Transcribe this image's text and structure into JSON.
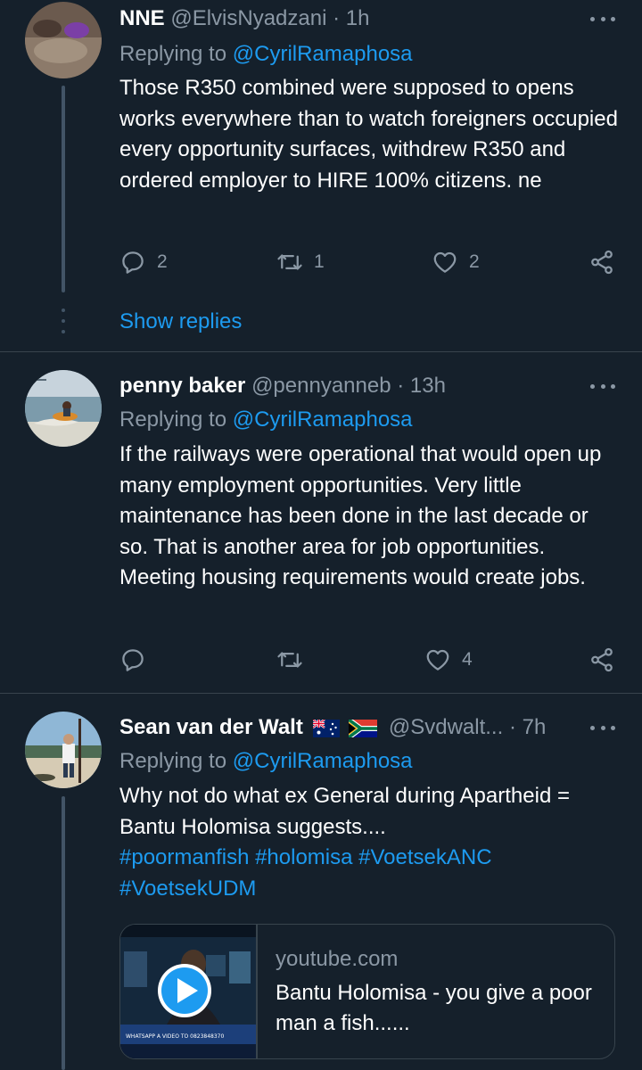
{
  "tweets": [
    {
      "name": "NNE",
      "handle": "@ElvisNyadzani",
      "separator": "·",
      "time": "1h",
      "replying_prefix": "Replying to",
      "replying_to": "@CyrilRamaphosa",
      "text": "Those R350 combined were supposed to opens works everywhere than to watch foreigners occupied every opportunity surfaces, withdrew R350 and ordered employer to HIRE 100% citizens. ne",
      "replies": "2",
      "retweets": "1",
      "likes": "2",
      "show_replies": "Show replies"
    },
    {
      "name": "penny baker",
      "handle": "@pennyanneb",
      "separator": "·",
      "time": "13h",
      "replying_prefix": "Replying to",
      "replying_to": "@CyrilRamaphosa",
      "text": "If the railways were operational that would open up many employment opportunities.  Very little maintenance has been done in the last decade or so.  That is another area for job opportunities.  Meeting housing requirements would create jobs.",
      "replies": "",
      "retweets": "",
      "likes": "4"
    },
    {
      "name": "Sean van der Walt",
      "flags": [
        "australia-flag",
        "south-africa-flag"
      ],
      "handle": "@Svdwalt...",
      "separator": "·",
      "time": "7h",
      "replying_prefix": "Replying to",
      "replying_to": "@CyrilRamaphosa",
      "text": "Why not do what ex General during Apartheid = Bantu Holomisa suggests....",
      "hashtags_line1": "#poormanfish #holomisa #VoetsekANC",
      "hashtags_line2": "#VoetsekUDM",
      "card": {
        "domain": "youtube.com",
        "title": "Bantu Holomisa - you give a poor man a fish......",
        "thumb_caption": "WHATSAPP A VIDEO TO 0823848370"
      }
    }
  ],
  "colors": {
    "background": "#15202b",
    "text": "#ffffff",
    "muted": "#8b98a5",
    "accent": "#1d9bf0",
    "divider": "#38444d",
    "thread": "#425466"
  }
}
